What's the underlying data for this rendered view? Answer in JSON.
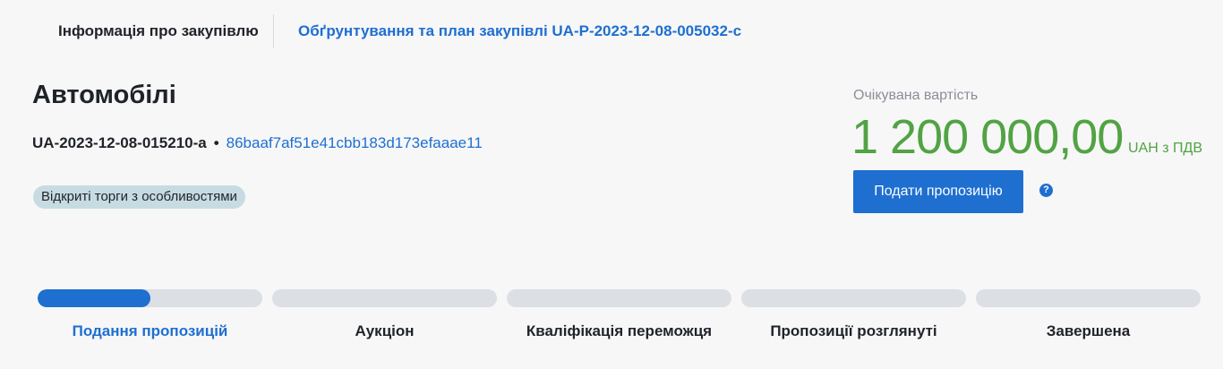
{
  "tabs": {
    "info_label": "Інформація про закупівлю",
    "plan_label": "Обґрунтування та план закупівлі UA-P-2023-12-08-005032-c"
  },
  "tender": {
    "title": "Автомобілі",
    "id": "UA-2023-12-08-015210-a",
    "separator": "•",
    "hash": "86baaf7af51e41cbb183d173efaaae11",
    "procedure_badge": "Відкриті торги з особливостями"
  },
  "expected": {
    "label": "Очікувана вартість",
    "value": "1 200 000,00",
    "currency": "UAH з ПДВ",
    "value_color": "#51a343"
  },
  "actions": {
    "submit_label": "Подати пропозицію",
    "help_glyph": "?",
    "accent_color": "#1e6fd0"
  },
  "stages": [
    {
      "label": "Подання пропозицій",
      "progress": 0.5,
      "active": true
    },
    {
      "label": "Аукціон",
      "progress": 0,
      "active": false
    },
    {
      "label": "Кваліфікація переможця",
      "progress": 0,
      "active": false
    },
    {
      "label": "Пропозиції розглянуті",
      "progress": 0,
      "active": false
    },
    {
      "label": "Завершена",
      "progress": 0,
      "active": false
    }
  ]
}
